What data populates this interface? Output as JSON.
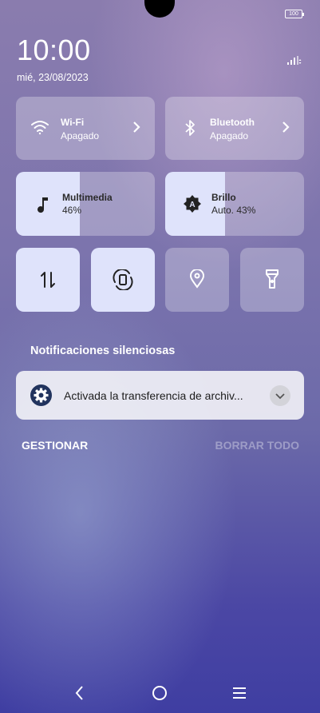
{
  "status_bar": {
    "battery": "100"
  },
  "header": {
    "time": "10:00",
    "date": "mié, 23/08/2023"
  },
  "tiles": {
    "wifi": {
      "label": "Wi-Fi",
      "status": "Apagado"
    },
    "bluetooth": {
      "label": "Bluetooth",
      "status": "Apagado"
    },
    "media": {
      "label": "Multimedia",
      "value": "46%",
      "level": 0.46
    },
    "brightness": {
      "label": "Brillo",
      "value": "Auto. 43%",
      "level": 0.43
    }
  },
  "notifications": {
    "section_title": "Notificaciones silenciosas",
    "items": [
      {
        "text": "Activada la transferencia de archiv..."
      }
    ],
    "manage_label": "GESTIONAR",
    "clear_label": "BORRAR TODO"
  },
  "icons": {
    "wifi": "wifi-icon",
    "bluetooth": "bluetooth-icon",
    "music": "music-note-icon",
    "brightness": "brightness-auto-icon",
    "data": "mobile-data-icon",
    "rotate": "auto-rotate-icon",
    "location": "location-icon",
    "flashlight": "flashlight-icon",
    "settings": "gear-icon"
  },
  "colors": {
    "tile_active": "#dfe3fb",
    "notif_icon_bg": "#21335d"
  }
}
